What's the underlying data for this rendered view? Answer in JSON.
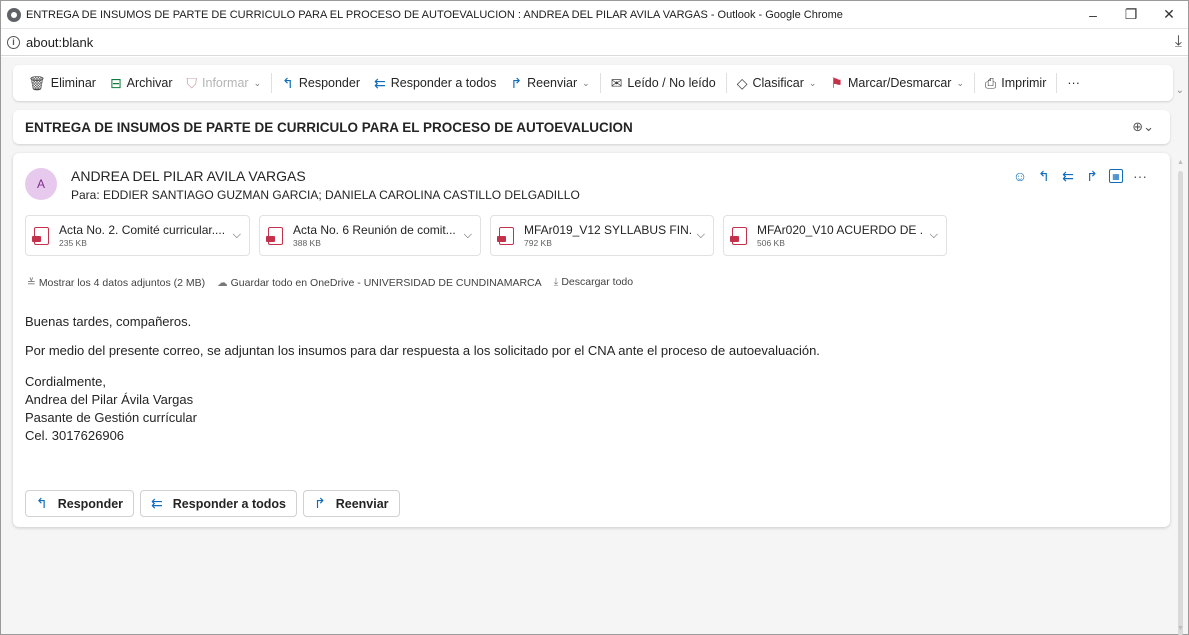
{
  "window": {
    "title": "ENTREGA DE INSUMOS DE PARTE DE CURRICULO PARA EL PROCESO DE AUTOEVALUCION : ANDREA DEL PILAR AVILA VARGAS - Outlook - Google Chrome",
    "minimize": "–",
    "restore": "❐",
    "close": "✕"
  },
  "address": {
    "url": "about:blank"
  },
  "toolbar": {
    "delete": "Eliminar",
    "archive": "Archivar",
    "report": "Informar",
    "reply": "Responder",
    "reply_all": "Responder a todos",
    "forward": "Reenviar",
    "read_unread": "Leído / No leído",
    "categorize": "Clasificar",
    "flag": "Marcar/Desmarcar",
    "print": "Imprimir",
    "more": "···"
  },
  "subject": "ENTREGA DE INSUMOS DE PARTE DE CURRICULO PARA EL PROCESO DE AUTOEVALUCION",
  "message": {
    "avatar_initial": "A",
    "sender": "ANDREA DEL PILAR AVILA VARGAS",
    "recipients": "Para:  EDDIER SANTIAGO GUZMAN GARCIA;  DANIELA CAROLINA CASTILLO DELGADILLO",
    "attachments": [
      {
        "name": "Acta No. 2. Comité curricular....",
        "size": "235 KB"
      },
      {
        "name": "Acta No. 6 Reunión de comit...",
        "size": "388 KB"
      },
      {
        "name": "MFAr019_V12 SYLLABUS FIN...",
        "size": "792 KB"
      },
      {
        "name": "MFAr020_V10 ACUERDO DE ...",
        "size": "506 KB"
      }
    ],
    "show_attachments": "Mostrar los 4 datos adjuntos (2 MB)",
    "save_onedrive": "Guardar todo en OneDrive - UNIVERSIDAD DE CUNDINAMARCA",
    "download_all": "Descargar todo",
    "body": {
      "greeting": "Buenas tardes, compañeros.",
      "paragraph": "Por medio del presente correo, se adjuntan los insumos para dar respuesta a los solicitado por el CNA ante el proceso de autoevaluación.",
      "closing": "Cordialmente,",
      "sig_name": "Andrea del Pilar Ávila Vargas",
      "sig_role": "Pasante de Gestión currícular",
      "sig_phone": "Cel. 3017626906"
    },
    "reply_buttons": {
      "reply": "Responder",
      "reply_all": "Responder a todos",
      "forward": "Reenviar"
    }
  },
  "colors": {
    "accent": "#0f6cbd",
    "danger": "#c4314b",
    "archive": "#0f7b3e",
    "avatar_bg": "#e8c9ee"
  }
}
